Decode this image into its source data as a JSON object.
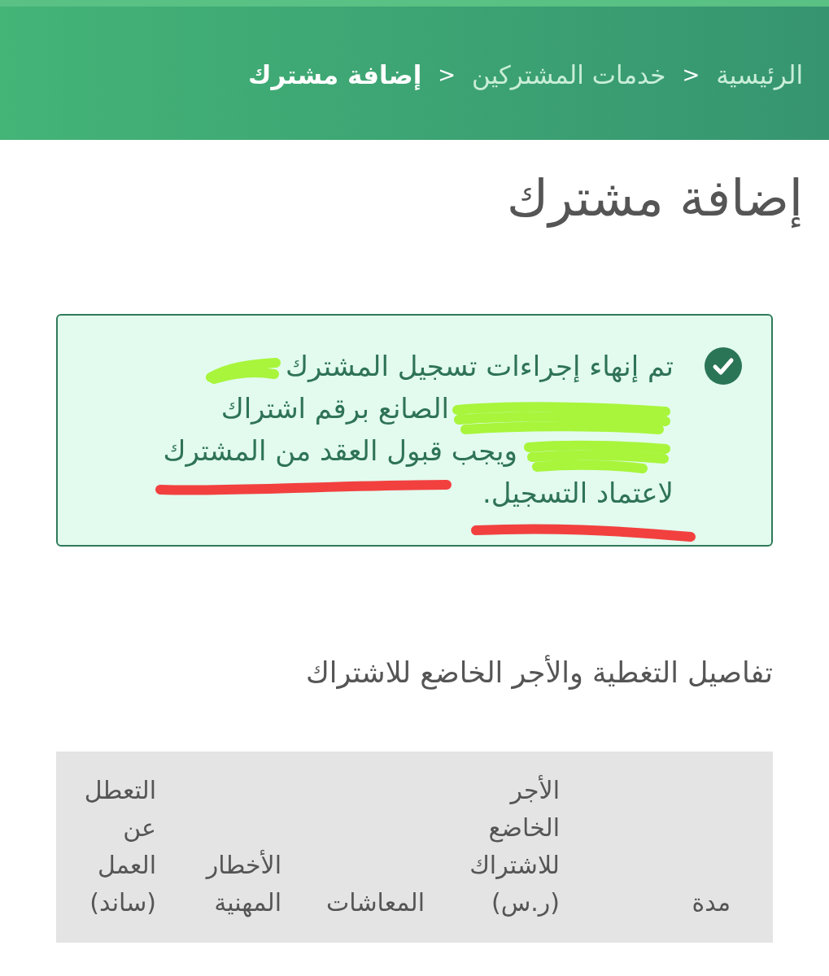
{
  "breadcrumb": [
    {
      "kind": "link",
      "label": "الرئيسية"
    },
    {
      "kind": "separator",
      "label": ">"
    },
    {
      "kind": "link",
      "label": "خدمات المشتركين"
    },
    {
      "kind": "separator",
      "label": ">"
    },
    {
      "kind": "current",
      "label": "إضافة مشترك"
    }
  ],
  "page_title": "إضافة مشترك",
  "alert": {
    "kind": "success",
    "lines": [
      "تم إنهاء إجراءات تسجيل المشترك",
      "الصانع برقم اشتراك",
      "ويجب قبول العقد من المشترك",
      "لاعتماد التسجيل."
    ]
  },
  "section_title": "تفاصيل التغطية والأجر الخاضع للاشتراك",
  "table": {
    "columns": [
      "مدة",
      "الأجر الخاضع للاشتراك (ر.س)",
      "المعاشات",
      "الأخطار المهنية",
      "التعطل عن العمل (ساند)"
    ]
  }
}
